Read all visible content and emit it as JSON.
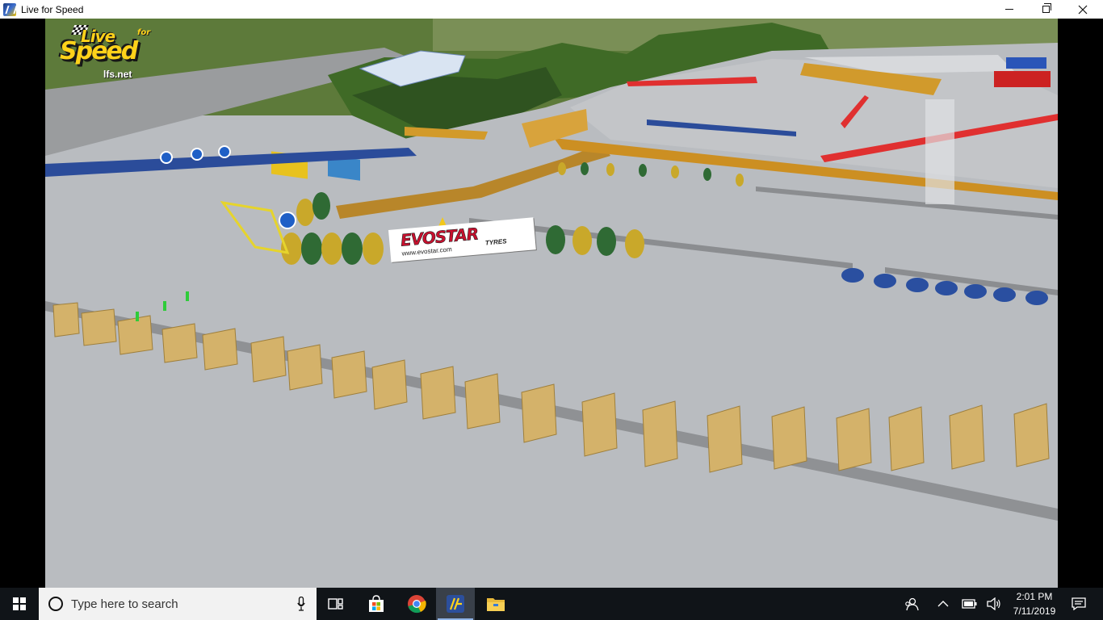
{
  "window": {
    "title": "Live for Speed"
  },
  "game": {
    "logo_live": "Live",
    "logo_for": "for",
    "logo_speed": "Speed",
    "logo_url": "lfs.net",
    "banner_brand": "EVOSTAR",
    "banner_sub": "TYRES",
    "banner_url": "www.evostar.com"
  },
  "taskbar": {
    "search_placeholder": "Type here to search",
    "clock_time": "2:01 PM",
    "clock_date": "7/11/2019"
  },
  "colors": {
    "taskbar_bg": "#101418",
    "asphalt": "#b9bcc0",
    "grass": "#5d7a3a",
    "logo_yellow": "#ffd21a",
    "banner_red": "#c8102e"
  },
  "icons": {
    "start": "windows-logo-icon",
    "search": "search-icon",
    "mic": "microphone-icon",
    "taskview": "task-view-icon",
    "store": "store-icon",
    "chrome": "chrome-icon",
    "lfs": "lfs-app-icon",
    "explorer": "folder-icon",
    "people": "people-icon",
    "chevron": "chevron-up-icon",
    "battery": "battery-icon",
    "volume": "volume-icon",
    "notifications": "notification-icon"
  }
}
